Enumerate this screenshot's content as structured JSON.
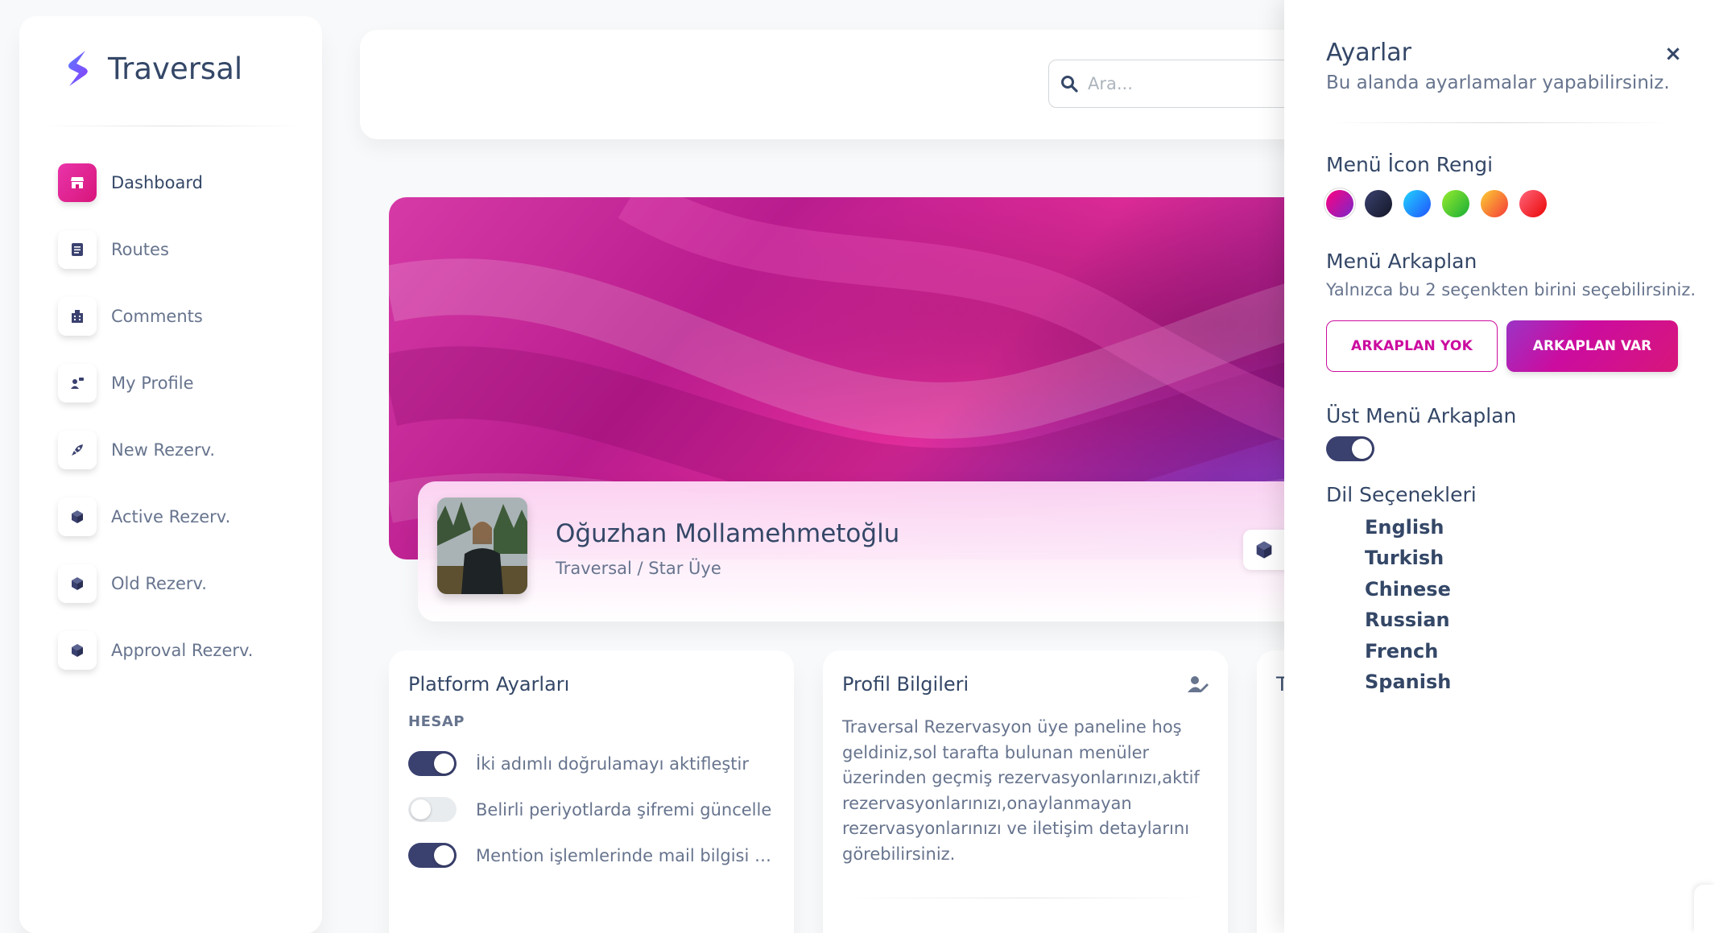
{
  "brand": {
    "name": "Traversal",
    "logo_icon": "traversal-s-logo"
  },
  "sidebar": {
    "items": [
      {
        "label": "Dashboard",
        "icon": "shop-icon",
        "active": true
      },
      {
        "label": "Routes",
        "icon": "document-icon",
        "active": false
      },
      {
        "label": "Comments",
        "icon": "office-icon",
        "active": false
      },
      {
        "label": "My Profile",
        "icon": "user-card-icon",
        "active": false
      },
      {
        "label": "New Rezerv.",
        "icon": "rocket-icon",
        "active": false
      },
      {
        "label": "Active Rezerv.",
        "icon": "box-icon",
        "active": false
      },
      {
        "label": "Old Rezerv.",
        "icon": "box-icon",
        "active": false
      },
      {
        "label": "Approval Rezerv.",
        "icon": "box-icon",
        "active": false
      }
    ]
  },
  "search": {
    "placeholder": "Ara...",
    "value": ""
  },
  "profile": {
    "name": "Oğuzhan Mollamehmetoğlu",
    "subtitle": "Traversal / Star Üye"
  },
  "platform_settings": {
    "title": "Platform Ayarları",
    "section": "HESAP",
    "toggles": [
      {
        "label": "İki adımlı doğrulamayı aktifleştir",
        "on": true
      },
      {
        "label": "Belirli periyotlarda şifremi güncelle",
        "on": false
      },
      {
        "label": "Mention işlemlerinde mail bilgisi gö...",
        "on": true
      }
    ]
  },
  "profile_info": {
    "title": "Profil Bilgileri",
    "text": "Traversal Rezervasyon üye paneline hoş geldiniz,sol tarafta bulunan menüler üzerinden geçmiş rezervasyonlarınızı,aktif rezervasyonlarınızı,onaylanmayan rezervasyonlarınızı ve iletişim detaylarını görebilirsiniz."
  },
  "third_card": {
    "title_visible": "T"
  },
  "settings_panel": {
    "title": "Ayarlar",
    "subtitle": "Bu alanda ayarlamalar yapabilirsiniz.",
    "icon_color_heading": "Menü İcon Rengi",
    "icon_colors": [
      "#cb0c9f",
      "#2d3150",
      "#2196f3",
      "#52c41a",
      "#fb8c00",
      "#f5222d"
    ],
    "menu_bg_heading": "Menü Arkaplan",
    "menu_bg_note": "Yalnızca bu 2 seçenkten birini seçebilirsiniz.",
    "btn_no_bg": "ARKAPLAN YOK",
    "btn_with_bg": "ARKAPLAN VAR",
    "top_menu_heading": "Üst Menü Arkaplan",
    "top_menu_bg_on": true,
    "lang_heading": "Dil Seçenekleri",
    "languages": [
      "English",
      "Turkish",
      "Chinese",
      "Russian",
      "French",
      "Spanish"
    ]
  }
}
